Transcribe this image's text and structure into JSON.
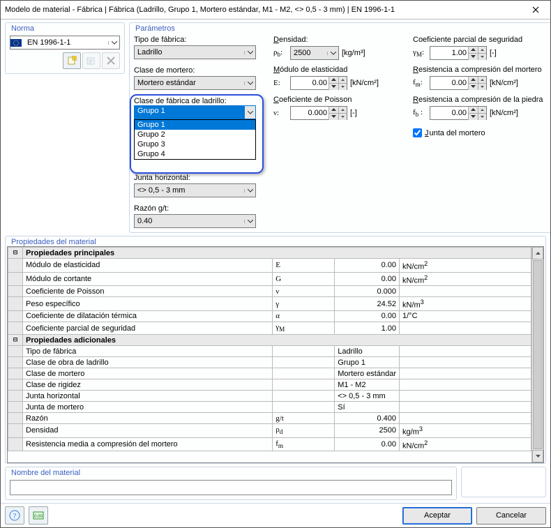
{
  "title": "Modelo de material - Fábrica | Fábrica (Ladrillo, Grupo 1, Mortero estándar, M1 - M2, <> 0,5 - 3 mm) | EN 1996-1-1",
  "norma": {
    "title": "Norma",
    "value": "EN 1996-1-1"
  },
  "params": {
    "title": "Parámetros",
    "tipo": {
      "label": "Tipo de fábrica:",
      "value": "Ladrillo"
    },
    "clase_mortero": {
      "label": "Clase de mortero:",
      "value": "Mortero estándar"
    },
    "clase_ladrillo": {
      "label": "Clase de fábrica de ladrillo:",
      "selected": "Grupo 1",
      "options": [
        "Grupo 1",
        "Grupo 2",
        "Grupo 3",
        "Grupo 4"
      ]
    },
    "junta_h": {
      "label": "Junta horizontal:",
      "value": "<> 0,5 - 3 mm"
    },
    "razon": {
      "label": "Razón g/t:",
      "value": "0.40"
    },
    "densidad": {
      "label": "Densidad:",
      "sym": "ρ",
      "sub": "b",
      "value": "2500",
      "unit": "[kg/m³]"
    },
    "elasticidad": {
      "label": "Módulo de elasticidad",
      "sym": "E:",
      "value": "0.00",
      "unit": "[kN/cm²]"
    },
    "poisson": {
      "label": "Coeficiente de Poisson",
      "sym": "ν:",
      "value": "0.000",
      "unit": "[-]"
    },
    "gamma": {
      "label": "Coeficiente parcial de seguridad",
      "sym": "γ",
      "sub": "M",
      "value": "1.00",
      "unit": "[-]"
    },
    "fm": {
      "label": "Resistencia a compresión del mortero",
      "sym": "f",
      "sub": "m",
      "value": "0.00",
      "unit": "[kN/cm²]"
    },
    "fb": {
      "label": "Resistencia a compresión de la piedra",
      "sym": "f",
      "sub": "b",
      "value": "0.00",
      "unit": "[kN/cm²]"
    },
    "junta_mortero": {
      "label": "Junta del mortero",
      "checked": true
    }
  },
  "props": {
    "title": "Propiedades del material",
    "h1": "Propiedades principales",
    "rows1": [
      {
        "name": "Módulo de elasticidad",
        "sym": "E",
        "val": "0.00",
        "unit": "kN/cm²"
      },
      {
        "name": "Módulo de cortante",
        "sym": "G",
        "val": "0.00",
        "unit": "kN/cm²"
      },
      {
        "name": "Coeficiente de Poisson",
        "sym": "ν",
        "val": "0.000",
        "unit": ""
      },
      {
        "name": "Peso específico",
        "sym": "γ",
        "val": "24.52",
        "unit": "kN/m³"
      },
      {
        "name": "Coeficiente de dilatación térmica",
        "sym": "α",
        "val": "0.00",
        "unit": "1/°C"
      },
      {
        "name": "Coeficiente parcial de seguridad",
        "sym": "γM",
        "val": "1.00",
        "unit": ""
      }
    ],
    "h2": "Propiedades adicionales",
    "rows2": [
      {
        "name": "Tipo de fábrica",
        "sym": "",
        "val": "Ladrillo",
        "align": "left"
      },
      {
        "name": "Clase de obra de ladrillo",
        "sym": "",
        "val": "Grupo 1",
        "align": "left"
      },
      {
        "name": "Clase de mortero",
        "sym": "",
        "val": "Mortero estándar",
        "align": "left"
      },
      {
        "name": "Clase de rigidez",
        "sym": "",
        "val": "M1 - M2",
        "align": "left"
      },
      {
        "name": "Junta horizontal",
        "sym": "",
        "val": "<> 0,5 - 3 mm",
        "align": "left"
      },
      {
        "name": "Junta de mortero",
        "sym": "",
        "val": "Sí",
        "align": "left"
      },
      {
        "name": "Razón",
        "sym": "g/t",
        "val": "0.400",
        "unit": ""
      },
      {
        "name": "Densidad",
        "sym": "ρd",
        "val": "2500",
        "unit": "kg/m³"
      },
      {
        "name": "Resistencia media a compresión del mortero",
        "sym": "fm",
        "val": "0.00",
        "unit": "kN/cm²"
      }
    ]
  },
  "name_panel": {
    "title": "Nombre del material"
  },
  "buttons": {
    "accept": "Aceptar",
    "cancel": "Cancelar"
  }
}
